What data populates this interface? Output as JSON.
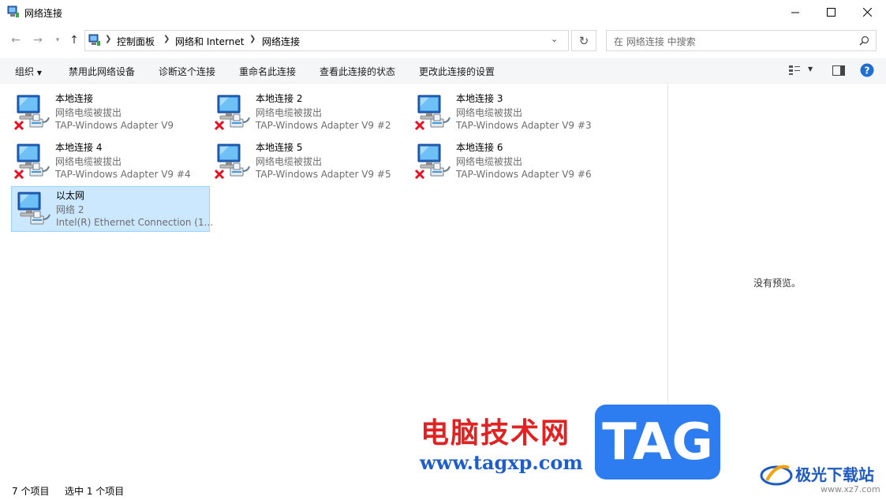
{
  "window": {
    "title": "网络连接"
  },
  "nav": {
    "breadcrumbs": [
      "控制面板",
      "网络和 Internet",
      "网络连接"
    ],
    "search_placeholder": "在 网络连接 中搜索"
  },
  "toolbar": {
    "organize": "组织",
    "disable": "禁用此网络设备",
    "diagnose": "诊断这个连接",
    "rename": "重命名此连接",
    "view_status": "查看此连接的状态",
    "change_settings": "更改此连接的设置"
  },
  "connections": [
    {
      "name": "本地连接",
      "status": "网络电缆被拔出",
      "device": "TAP-Windows Adapter V9",
      "disconnected": true
    },
    {
      "name": "本地连接 2",
      "status": "网络电缆被拔出",
      "device": "TAP-Windows Adapter V9 #2",
      "disconnected": true
    },
    {
      "name": "本地连接 3",
      "status": "网络电缆被拔出",
      "device": "TAP-Windows Adapter V9 #3",
      "disconnected": true
    },
    {
      "name": "本地连接 4",
      "status": "网络电缆被拔出",
      "device": "TAP-Windows Adapter V9 #4",
      "disconnected": true
    },
    {
      "name": "本地连接 5",
      "status": "网络电缆被拔出",
      "device": "TAP-Windows Adapter V9 #5",
      "disconnected": true
    },
    {
      "name": "本地连接 6",
      "status": "网络电缆被拔出",
      "device": "TAP-Windows Adapter V9 #6",
      "disconnected": true
    },
    {
      "name": "以太网",
      "status": "网络 2",
      "device": "Intel(R) Ethernet Connection (1...",
      "disconnected": false,
      "selected": true
    }
  ],
  "preview": {
    "text": "没有预览。"
  },
  "statusbar": {
    "count": "7 个项目",
    "selection": "选中 1 个项目"
  },
  "watermark": {
    "cn": "电脑技术网",
    "url": "www.tagxp.com",
    "tag": "TAG",
    "site": "极光下载站",
    "site2": "www.xz7.com"
  },
  "colors": {
    "selection_bg": "#cce8ff",
    "selection_border": "#99d1ff",
    "error_x": "#e81123",
    "help": "#1f6fd1"
  }
}
